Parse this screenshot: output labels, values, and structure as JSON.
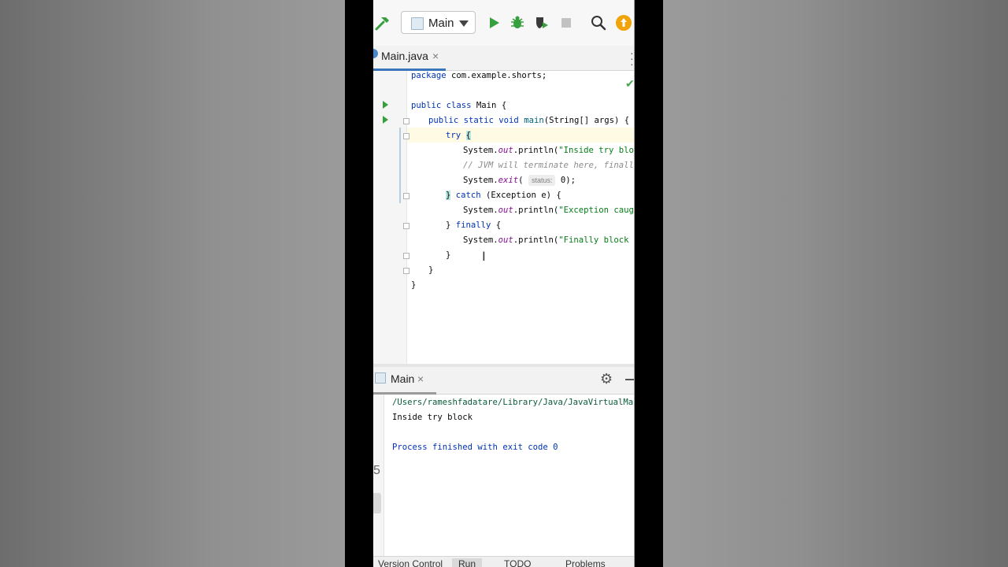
{
  "toolbar": {
    "run_config_label": "Main",
    "icons": [
      "hammer-icon",
      "run-config-icon",
      "chevron-down-icon",
      "run-icon",
      "debug-icon",
      "coverage-icon",
      "stop-icon",
      "search-icon",
      "update-icon"
    ],
    "colors": {
      "run": "#36a03f",
      "update": "#f0a30a",
      "build": "#36a03f"
    }
  },
  "editor_tab": {
    "label": "Main.java",
    "close": "×"
  },
  "code": {
    "l1_kw": "package",
    "l1_rest": " com.example.shorts;",
    "l3_kw": "public class",
    "l3_rest": " Main {",
    "l4_kw": "public static void",
    "l4_fn": "main",
    "l4_rest": "(String[] args) {",
    "l5_kw": "try",
    "l5_brace": "{",
    "l6_a": "System.",
    "l6_fld": "out",
    "l6_b": ".println(",
    "l6_str": "\"Inside try block\"",
    "l6_c": ");",
    "l7_cmt": "// JVM will terminate here, finally bloc",
    "l8_a": "System.",
    "l8_fn": "exit",
    "l8_b": "(",
    "l8_hint": "status:",
    "l8_c": " 0);",
    "l9_brace": "}",
    "l9_kw": "catch",
    "l9_rest": " (Exception e) {",
    "l10_a": "System.",
    "l10_fld": "out",
    "l10_b": ".println(",
    "l10_str": "\"Exception caught: \"",
    "l11_a": "} ",
    "l11_kw": "finally",
    "l11_b": " {",
    "l12_a": "System.",
    "l12_fld": "out",
    "l12_b": ".println(",
    "l12_str": "\"Finally block is exe",
    "l13": "}",
    "l14": "}",
    "l15": "}"
  },
  "run_panel": {
    "tab_label": "Main",
    "close": "×",
    "lines": [
      "/Users/rameshfadatare/Library/Java/JavaVirtualMachines/c",
      "Inside try block",
      "",
      "Process finished with exit code 0"
    ],
    "gutter_glyphs": [
      "5",
      "⤓"
    ]
  },
  "bottom_tabs": [
    "Version Control",
    "Run",
    "TODO",
    "Problems"
  ]
}
